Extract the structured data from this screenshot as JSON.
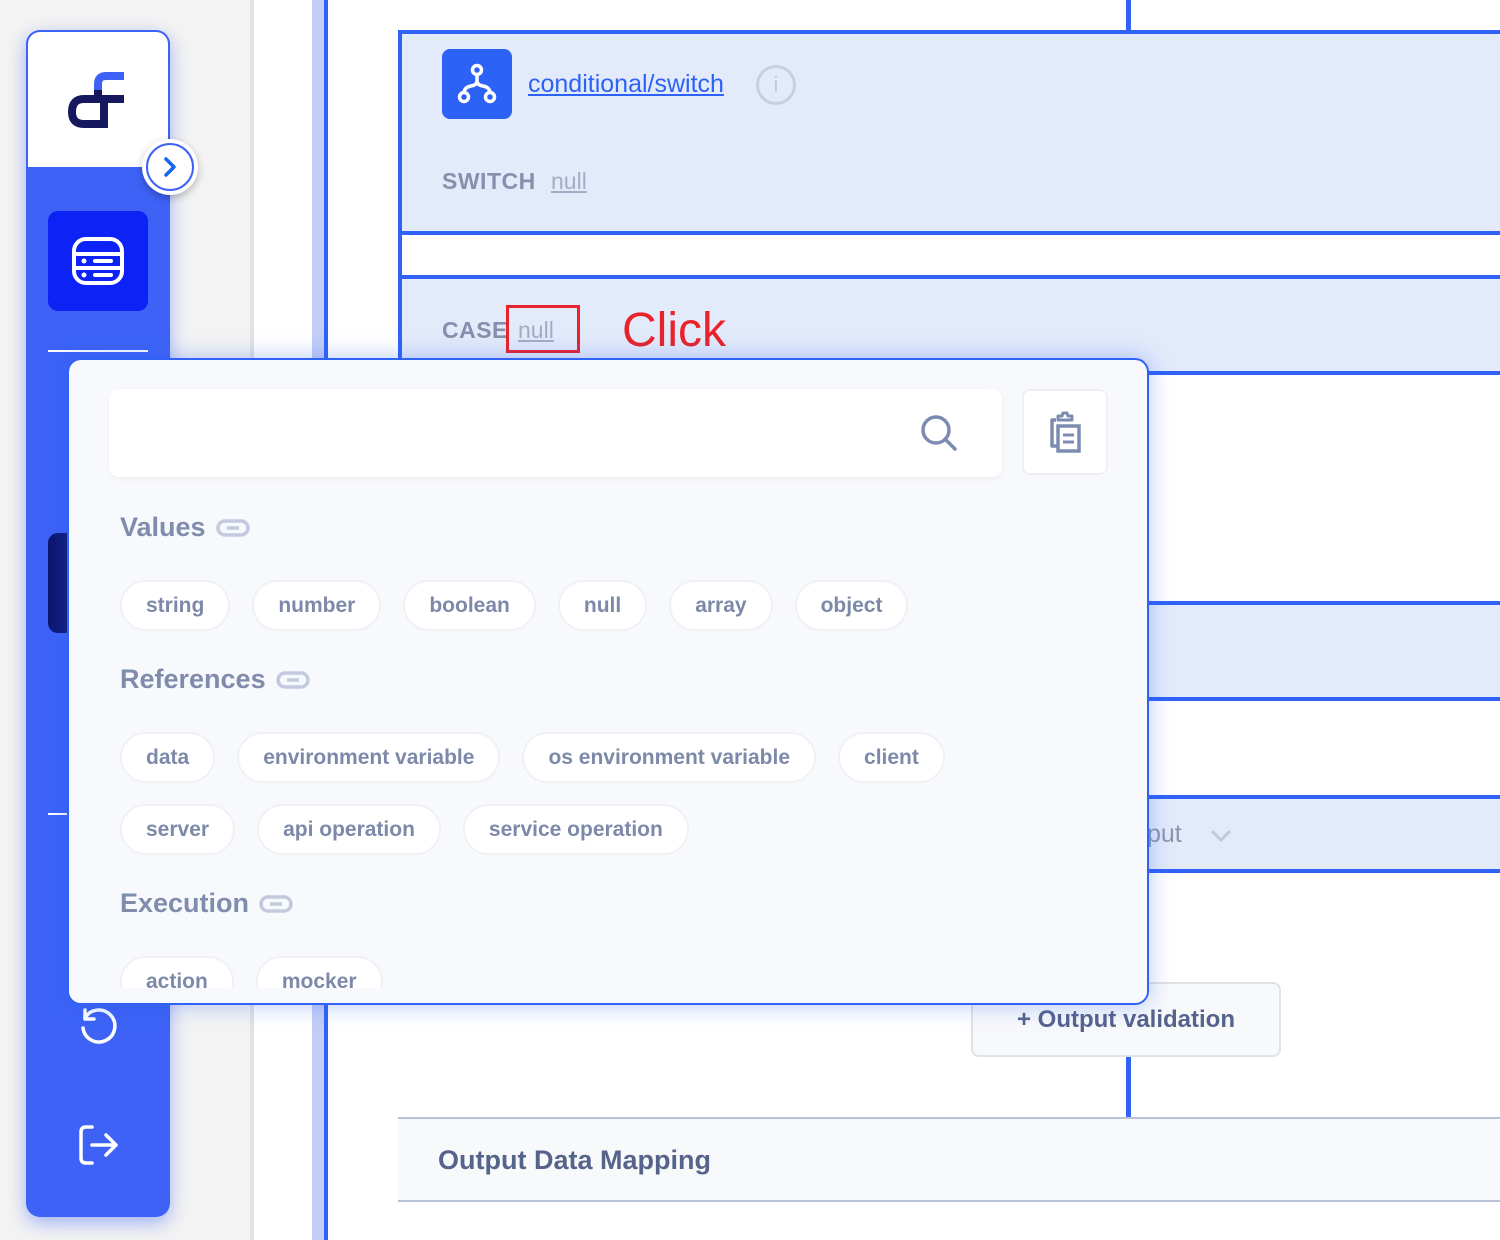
{
  "sidebar": {
    "logo_label": "app-logo",
    "expand_icon": "chevron-right-icon",
    "active_item_icon": "server-stack-icon",
    "history_icon": "history-icon",
    "logout_icon": "logout-icon"
  },
  "canvas": {
    "switch_card": {
      "icon": "branch-icon",
      "title_link": "conditional/switch",
      "info_icon_glyph": "i",
      "field_label": "SWITCH",
      "field_value": "null"
    },
    "case_card": {
      "field_label": "CASE",
      "field_value": "null"
    },
    "output_row": {
      "partial_label": "tput",
      "chevron_icon": "chevron-down-icon"
    },
    "output_validation_button": "+ Output validation",
    "output_mapping_title": "Output Data Mapping"
  },
  "annotation": {
    "label": "Click",
    "color": "#e8232a"
  },
  "popover": {
    "search": {
      "value": "",
      "placeholder": ""
    },
    "paste_icon": "clipboard-icon",
    "sections": [
      {
        "title": "Values",
        "icon": "link-icon",
        "items": [
          "string",
          "number",
          "boolean",
          "null",
          "array",
          "object"
        ]
      },
      {
        "title": "References",
        "icon": "link-icon",
        "items": [
          "data",
          "environment variable",
          "os environment variable",
          "client",
          "server",
          "api operation",
          "service operation"
        ]
      },
      {
        "title": "Execution",
        "icon": "link-icon",
        "items": [
          "action",
          "mocker"
        ]
      }
    ]
  },
  "colors": {
    "accent": "#2f62f5",
    "sidebar": "#3d62f5",
    "sidebar_active": "#0d22f4",
    "card_bg": "#e3eafa",
    "muted_text": "#7d89a9"
  }
}
